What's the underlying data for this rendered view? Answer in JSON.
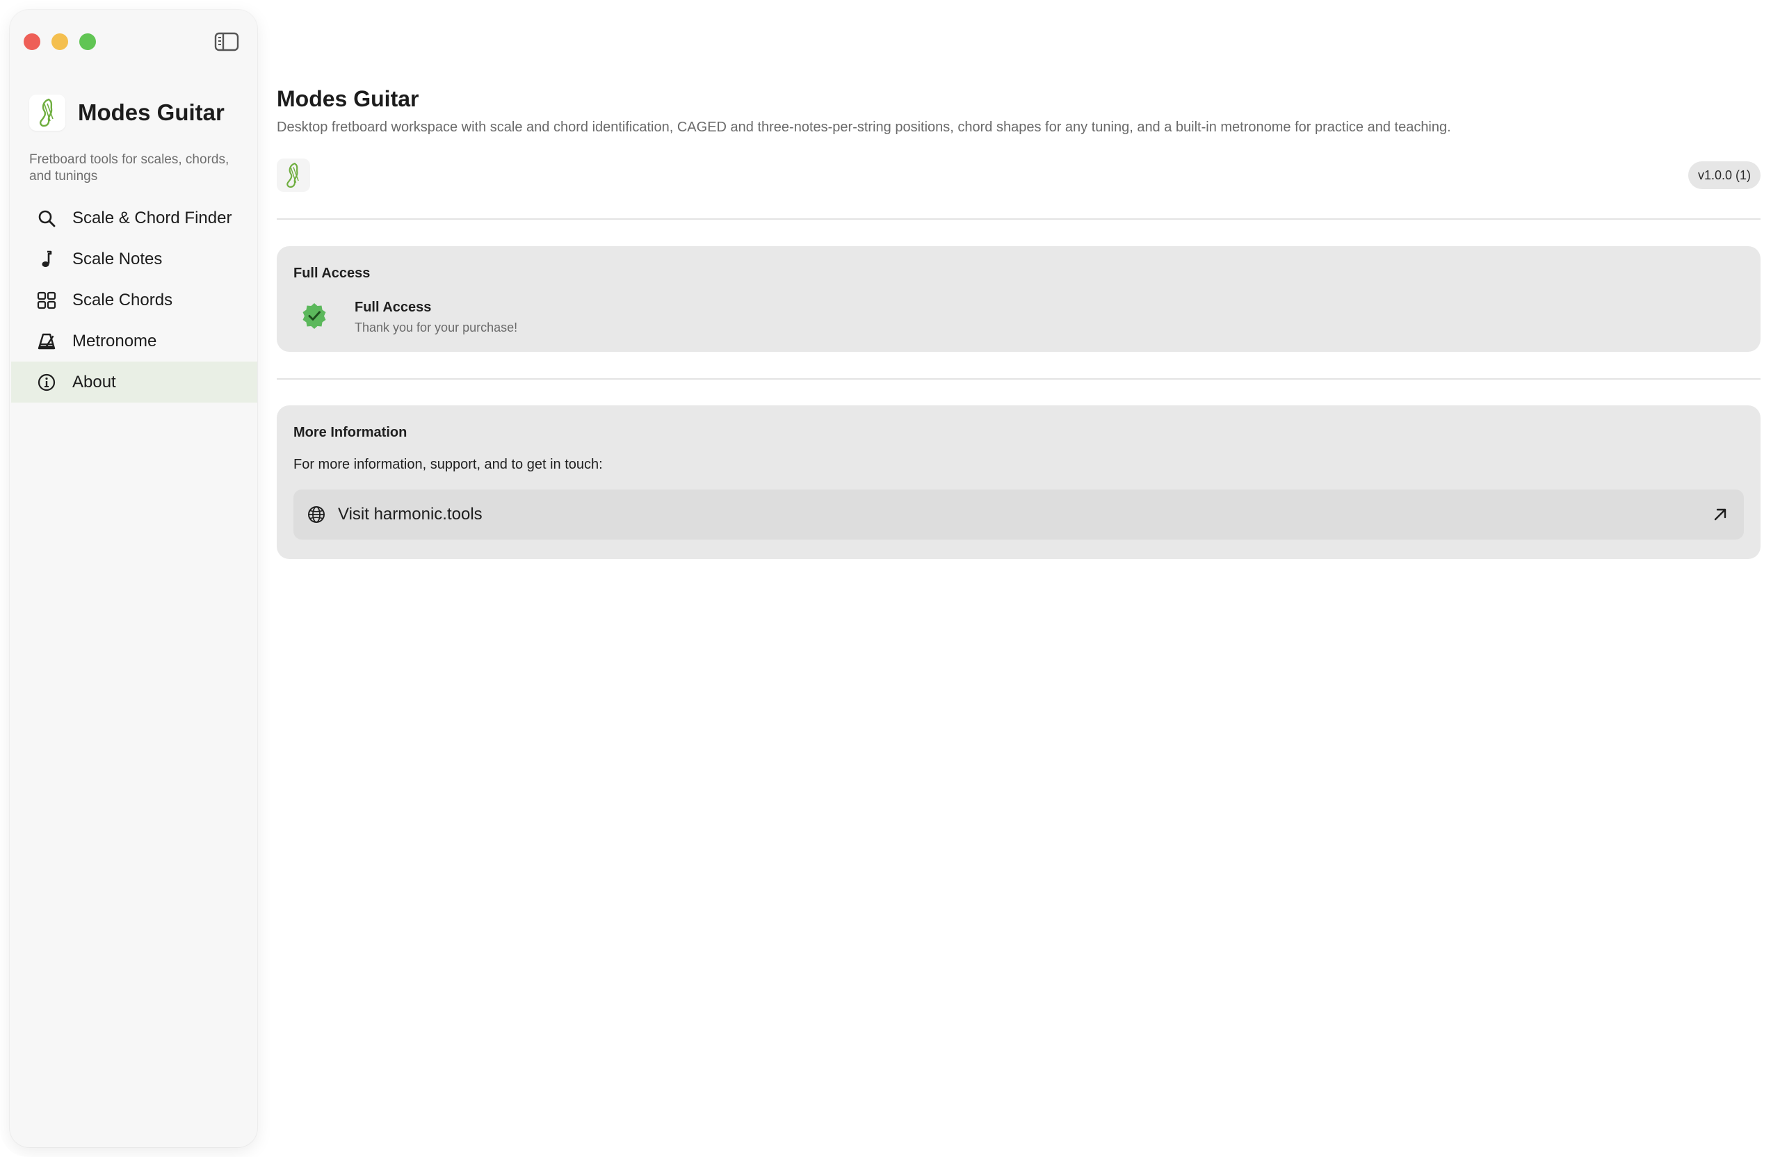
{
  "app": {
    "name": "Modes Guitar",
    "tagline": "Fretboard tools for scales, chords, and tunings"
  },
  "sidebar": {
    "items": [
      {
        "label": "Scale & Chord Finder",
        "icon": "search-icon",
        "active": false
      },
      {
        "label": "Scale Notes",
        "icon": "music-note-icon",
        "active": false
      },
      {
        "label": "Scale Chords",
        "icon": "grid-icon",
        "active": false
      },
      {
        "label": "Metronome",
        "icon": "metronome-icon",
        "active": false
      },
      {
        "label": "About",
        "icon": "info-icon",
        "active": true
      }
    ]
  },
  "about": {
    "title": "Modes Guitar",
    "description": "Desktop fretboard workspace with scale and chord identification, CAGED and three-notes-per-string positions, chord shapes for any tuning, and a built-in metronome for practice and teaching.",
    "version": "v1.0.0 (1)"
  },
  "full_access": {
    "section_title": "Full Access",
    "status_title": "Full Access",
    "status_message": "Thank you for your purchase!"
  },
  "more_info": {
    "section_title": "More Information",
    "text": "For more information, support, and to get in touch:",
    "link_label": "Visit harmonic.tools",
    "link_icon": "globe-icon"
  },
  "colors": {
    "accent_green": "#5cb85c",
    "active_nav_bg": "#e9efe5"
  }
}
